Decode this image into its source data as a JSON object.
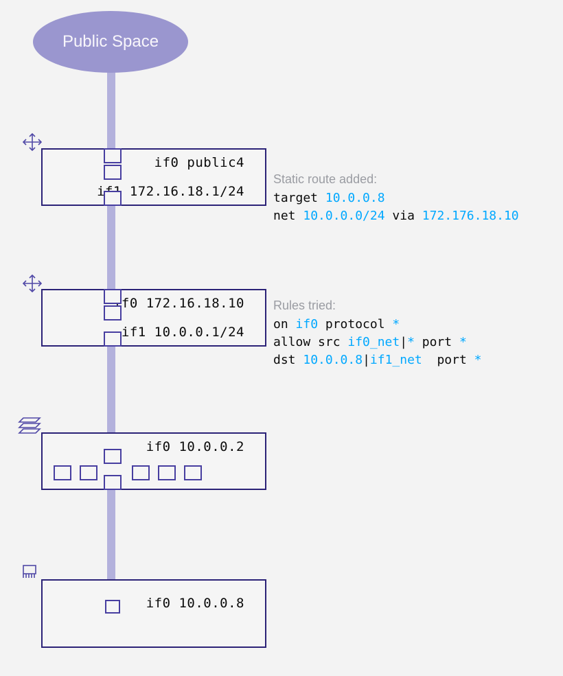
{
  "cloud": {
    "label": "Public Space"
  },
  "nodes": {
    "router1": {
      "type": "router",
      "if0": "if0 public4",
      "if1": "if1 172.16.18.1/24"
    },
    "router2": {
      "type": "router",
      "if0": "if0 172.16.18.10",
      "if1": "if1 10.0.0.1/24"
    },
    "switch": {
      "type": "switch",
      "if0": "if0 10.0.0.2"
    },
    "host": {
      "type": "host",
      "if0": "if0 10.0.0.8"
    }
  },
  "annotations": {
    "route": {
      "header": "Static route added:",
      "l1_k1": "target ",
      "l1_v1": "10.0.0.8",
      "l2_k1": "net ",
      "l2_v1": "10.0.0.0/24",
      "l2_k2": " via ",
      "l2_v2": "172.176.18.10"
    },
    "rules": {
      "header": "Rules tried:",
      "l1_k1": "on ",
      "l1_v1": "if0",
      "l1_k2": " protocol ",
      "l1_v2": "*",
      "l2_k1": "allow src ",
      "l2_v1": "if0_net",
      "l2_k2": "|",
      "l2_v2": "*",
      "l2_k3": " port ",
      "l2_v3": "*",
      "l3_k1": "dst ",
      "l3_v1": "10.0.0.8",
      "l3_k2": "|",
      "l3_v2": "if1_net",
      "l3_k3": "  port ",
      "l3_v3": "*"
    }
  }
}
